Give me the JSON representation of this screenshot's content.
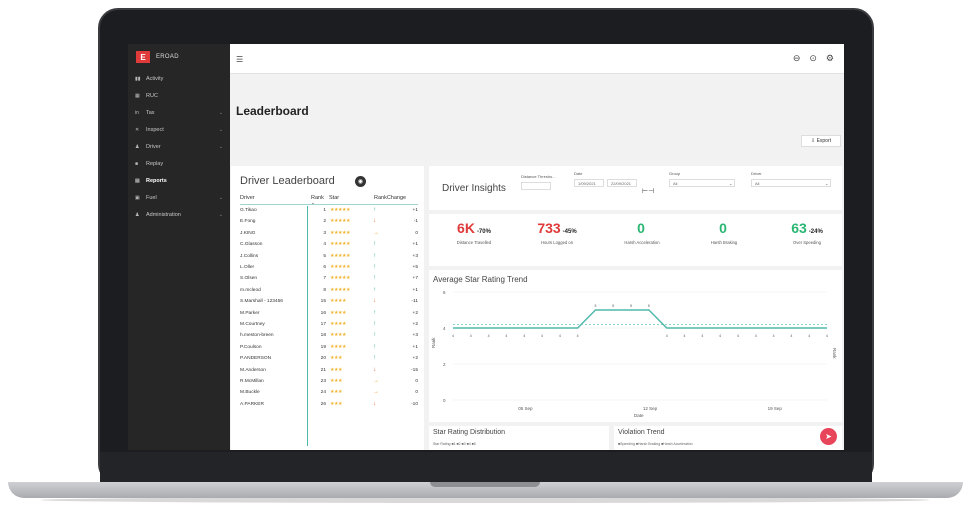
{
  "app": {
    "brand": "EROAD",
    "logo_mark": "E"
  },
  "sidebar": {
    "items": [
      {
        "label": "Activity",
        "icon": "▮▮",
        "chevron": false,
        "active": false
      },
      {
        "label": "RUC",
        "icon": "▦",
        "chevron": false,
        "active": false
      },
      {
        "label": "Tax",
        "icon": "in",
        "chevron": true,
        "active": false
      },
      {
        "label": "Inspect",
        "icon": "✕",
        "chevron": true,
        "active": false
      },
      {
        "label": "Driver",
        "icon": "♟",
        "chevron": true,
        "active": false
      },
      {
        "label": "Replay",
        "icon": "■",
        "chevron": false,
        "active": false
      },
      {
        "label": "Reports",
        "icon": "▤",
        "chevron": false,
        "active": true
      },
      {
        "label": "Fuel",
        "icon": "▣",
        "chevron": true,
        "active": false
      },
      {
        "label": "Administration",
        "icon": "♟",
        "chevron": true,
        "active": false
      }
    ]
  },
  "header": {
    "title": "Leaderboard",
    "export_label": "⇩ Export"
  },
  "leaderboard": {
    "title": "Driver Leaderboard",
    "columns": {
      "driver": "Driver",
      "rank": "Rank",
      "star": "Star",
      "rank_change": "RankChange"
    },
    "rows": [
      {
        "driver": "G.Tikao",
        "rank": "1",
        "stars": "★★★★★",
        "dir": "up",
        "change": "+1"
      },
      {
        "driver": "E.Fong",
        "rank": "2",
        "stars": "★★★★★",
        "dir": "down",
        "change": "-1"
      },
      {
        "driver": "J.KING",
        "rank": "3",
        "stars": "★★★★★",
        "dir": "same",
        "change": "0"
      },
      {
        "driver": "C.Glasson",
        "rank": "4",
        "stars": "★★★★★",
        "dir": "up",
        "change": "+1"
      },
      {
        "driver": "J.Collins",
        "rank": "5",
        "stars": "★★★★★",
        "dir": "up",
        "change": "+3"
      },
      {
        "driver": "L.Oller",
        "rank": "6",
        "stars": "★★★★★",
        "dir": "up",
        "change": "+5"
      },
      {
        "driver": "S.Olsen",
        "rank": "7",
        "stars": "★★★★★",
        "dir": "up",
        "change": "+7"
      },
      {
        "driver": "m.mcleod",
        "rank": "8",
        "stars": "★★★★★",
        "dir": "up",
        "change": "+1"
      },
      {
        "driver": "S.Marshall - 123456",
        "rank": "15",
        "stars": "★★★★",
        "dir": "down",
        "change": "-11"
      },
      {
        "driver": "M.Parker",
        "rank": "16",
        "stars": "★★★★",
        "dir": "up",
        "change": "+2"
      },
      {
        "driver": "M.Courtney",
        "rank": "17",
        "stars": "★★★★",
        "dir": "up",
        "change": "+2"
      },
      {
        "driver": "h.meston-breen",
        "rank": "18",
        "stars": "★★★★",
        "dir": "up",
        "change": "+3"
      },
      {
        "driver": "P.Coulson",
        "rank": "19",
        "stars": "★★★★",
        "dir": "up",
        "change": "+1"
      },
      {
        "driver": "P.ANDERSON",
        "rank": "20",
        "stars": "★★★",
        "dir": "up",
        "change": "+2"
      },
      {
        "driver": "M.Anderson",
        "rank": "21",
        "stars": "★★★",
        "dir": "down",
        "change": "-15"
      },
      {
        "driver": "R.McMillan",
        "rank": "23",
        "stars": "★★★",
        "dir": "same",
        "change": "0"
      },
      {
        "driver": "M.Buckle",
        "rank": "24",
        "stars": "★★★",
        "dir": "same",
        "change": "0"
      },
      {
        "driver": "A.PARKER",
        "rank": "26",
        "stars": "★★★",
        "dir": "down",
        "change": "-10"
      }
    ]
  },
  "insights": {
    "title": "Driver Insights",
    "filters": {
      "distance_label": "Distance Thresho...",
      "date_label": "Date",
      "date_from": "1/09/2021",
      "date_to": "22/09/2021",
      "group_label": "Group",
      "group_value": "All",
      "driver_label": "Driver",
      "driver_value": "All"
    },
    "metrics": [
      {
        "value": "6K",
        "pct": "-70%",
        "label": "Distance Travelled",
        "color": "#e03a3a"
      },
      {
        "value": "733",
        "pct": "-45%",
        "label": "Hours Logged on",
        "color": "#e03a3a"
      },
      {
        "value": "0",
        "pct": "",
        "label": "Harsh Acceleration",
        "color": "#2bb673"
      },
      {
        "value": "0",
        "pct": "",
        "label": "Harsh Braking",
        "color": "#2bb673"
      },
      {
        "value": "63",
        "pct": "-24%",
        "label": "Over Speeding",
        "color": "#2bb673"
      }
    ]
  },
  "chart_data": {
    "type": "line",
    "title": "Average Star Rating Trend",
    "xlabel": "Date",
    "ylabel": "Rank",
    "y2label": "Rank",
    "ylim": [
      0,
      6
    ],
    "yticks": [
      "0",
      "2",
      "4",
      "6"
    ],
    "xticks": [
      "05 Sep",
      "12 Sep",
      "19 Sep"
    ],
    "x": [
      "1 Sep",
      "2 Sep",
      "3 Sep",
      "4 Sep",
      "5 Sep",
      "6 Sep",
      "7 Sep",
      "8 Sep",
      "9 Sep",
      "10 Sep",
      "11 Sep",
      "12 Sep",
      "13 Sep",
      "14 Sep",
      "15 Sep",
      "16 Sep",
      "17 Sep",
      "18 Sep",
      "19 Sep",
      "20 Sep",
      "21 Sep",
      "22 Sep"
    ],
    "series": [
      {
        "values": [
          4,
          4,
          4,
          4,
          4,
          4,
          4,
          4,
          5,
          5,
          5,
          5,
          4,
          4,
          4,
          4,
          4,
          4,
          4,
          4,
          4,
          4
        ],
        "labels": [
          "4",
          "4",
          "4",
          "4",
          "4",
          "4",
          "4",
          "4",
          "5",
          "5",
          "5",
          "5",
          "4",
          "4",
          "4",
          "4",
          "4",
          "4",
          "4",
          "4",
          "4",
          "4"
        ],
        "color": "#4fb8aa"
      }
    ],
    "average": 4.2,
    "grid": true
  },
  "distribution": {
    "title": "Star Rating Distribution",
    "legend": "Star Rating  ■1 ■2 ■3 ■4 ■5"
  },
  "violation": {
    "title": "Violation Trend",
    "legend": "■Speeding ■Harsh Braking ■Harsh Acceleration"
  },
  "colors": {
    "accent": "#4fb8aa",
    "brand": "#e03a3a",
    "up": "#2bb673",
    "down": "#e45c2a",
    "same": "#f2a02c",
    "fab": "#e8455b"
  }
}
